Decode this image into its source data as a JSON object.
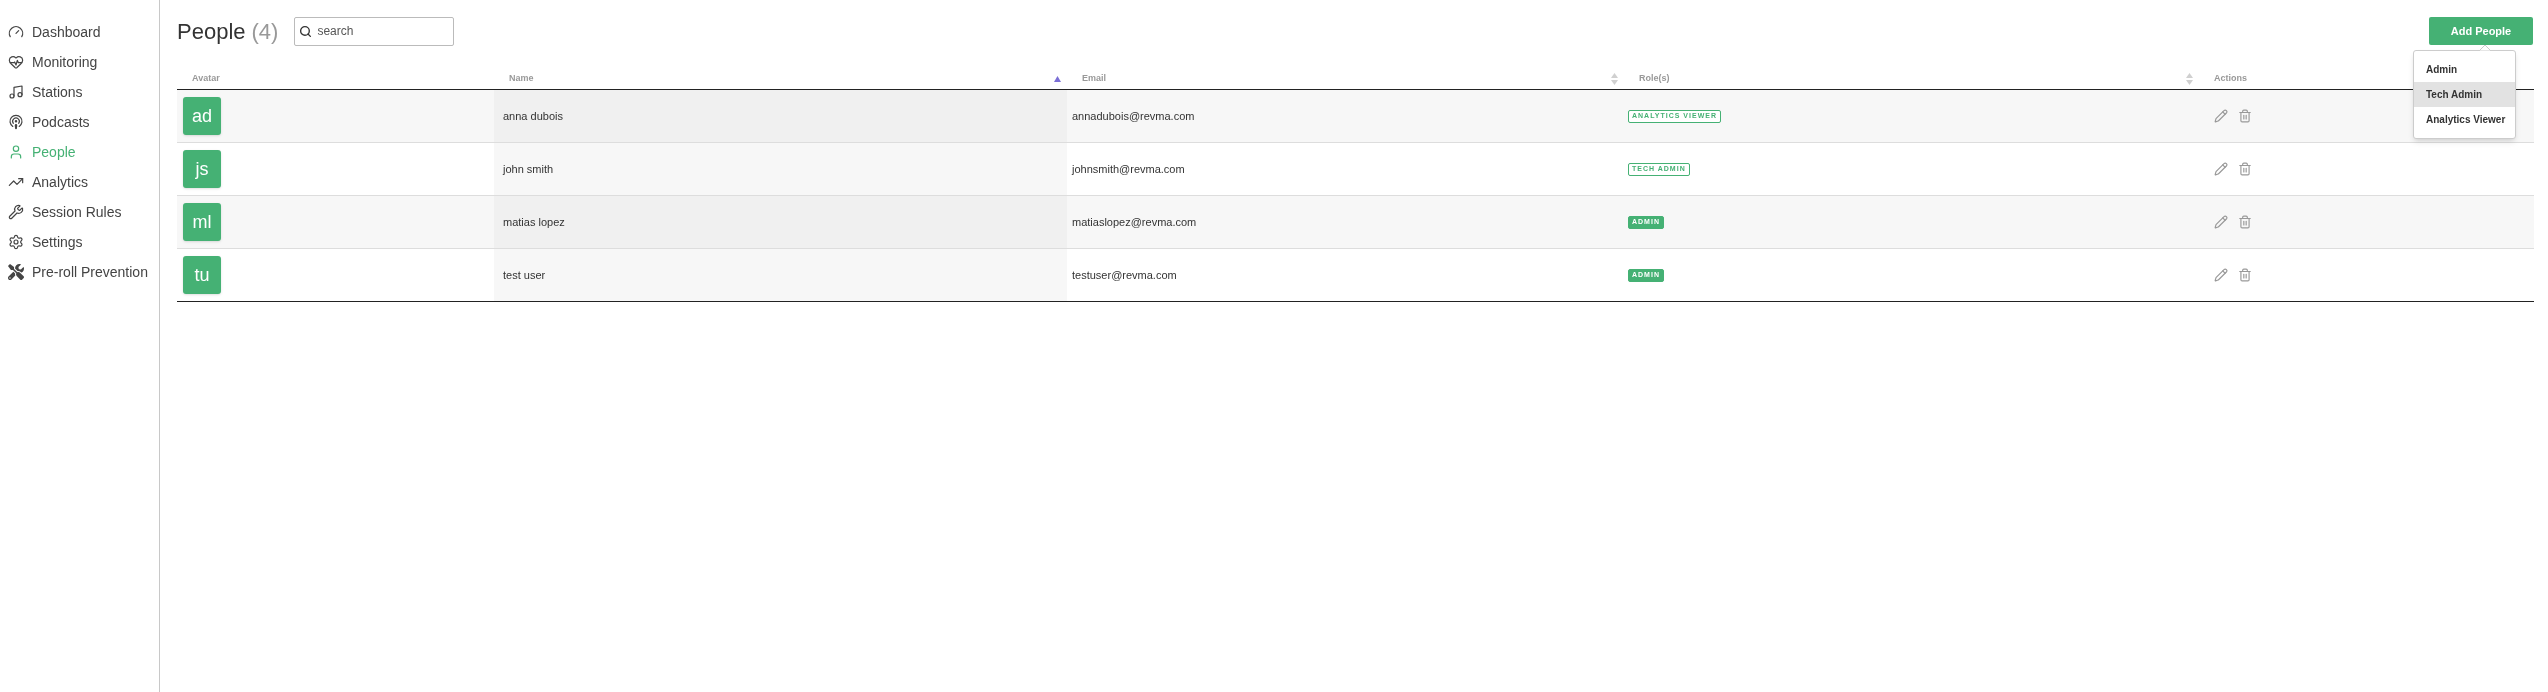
{
  "sidebar": {
    "items": [
      {
        "label": "Dashboard",
        "selected": false
      },
      {
        "label": "Monitoring",
        "selected": false
      },
      {
        "label": "Stations",
        "selected": false
      },
      {
        "label": "Podcasts",
        "selected": false
      },
      {
        "label": "People",
        "selected": true
      },
      {
        "label": "Analytics",
        "selected": false
      },
      {
        "label": "Session Rules",
        "selected": false
      },
      {
        "label": "Settings",
        "selected": false
      },
      {
        "label": "Pre-roll Prevention",
        "selected": false
      }
    ]
  },
  "header": {
    "title": "People",
    "count": "(4)",
    "search": {
      "placeholder": "search"
    },
    "add_button": "Add People",
    "add_menu": [
      {
        "label": "Admin",
        "selected": false
      },
      {
        "label": "Tech Admin",
        "selected": true
      },
      {
        "label": "Analytics Viewer",
        "selected": false
      }
    ]
  },
  "table": {
    "columns": [
      {
        "label": "Avatar",
        "sortable": false
      },
      {
        "label": "Name",
        "sortable": true,
        "sorted": true
      },
      {
        "label": "Email",
        "sortable": true,
        "sorted": false
      },
      {
        "label": "Role(s)",
        "sortable": true,
        "sorted": false
      },
      {
        "label": "Actions",
        "sortable": false
      }
    ],
    "rows": [
      {
        "initials": "ad",
        "name": "anna dubois",
        "email": "annadubois@revma.com",
        "role": {
          "label": "ANALYTICS VIEWER",
          "kind": "outline"
        }
      },
      {
        "initials": "js",
        "name": "john smith",
        "email": "johnsmith@revma.com",
        "role": {
          "label": "TECH ADMIN",
          "kind": "outline"
        }
      },
      {
        "initials": "ml",
        "name": "matias lopez",
        "email": "matiaslopez@revma.com",
        "role": {
          "label": "ADMIN",
          "kind": "filled"
        }
      },
      {
        "initials": "tu",
        "name": "test user",
        "email": "testuser@revma.com",
        "role": {
          "label": "ADMIN",
          "kind": "filled"
        }
      }
    ]
  }
}
